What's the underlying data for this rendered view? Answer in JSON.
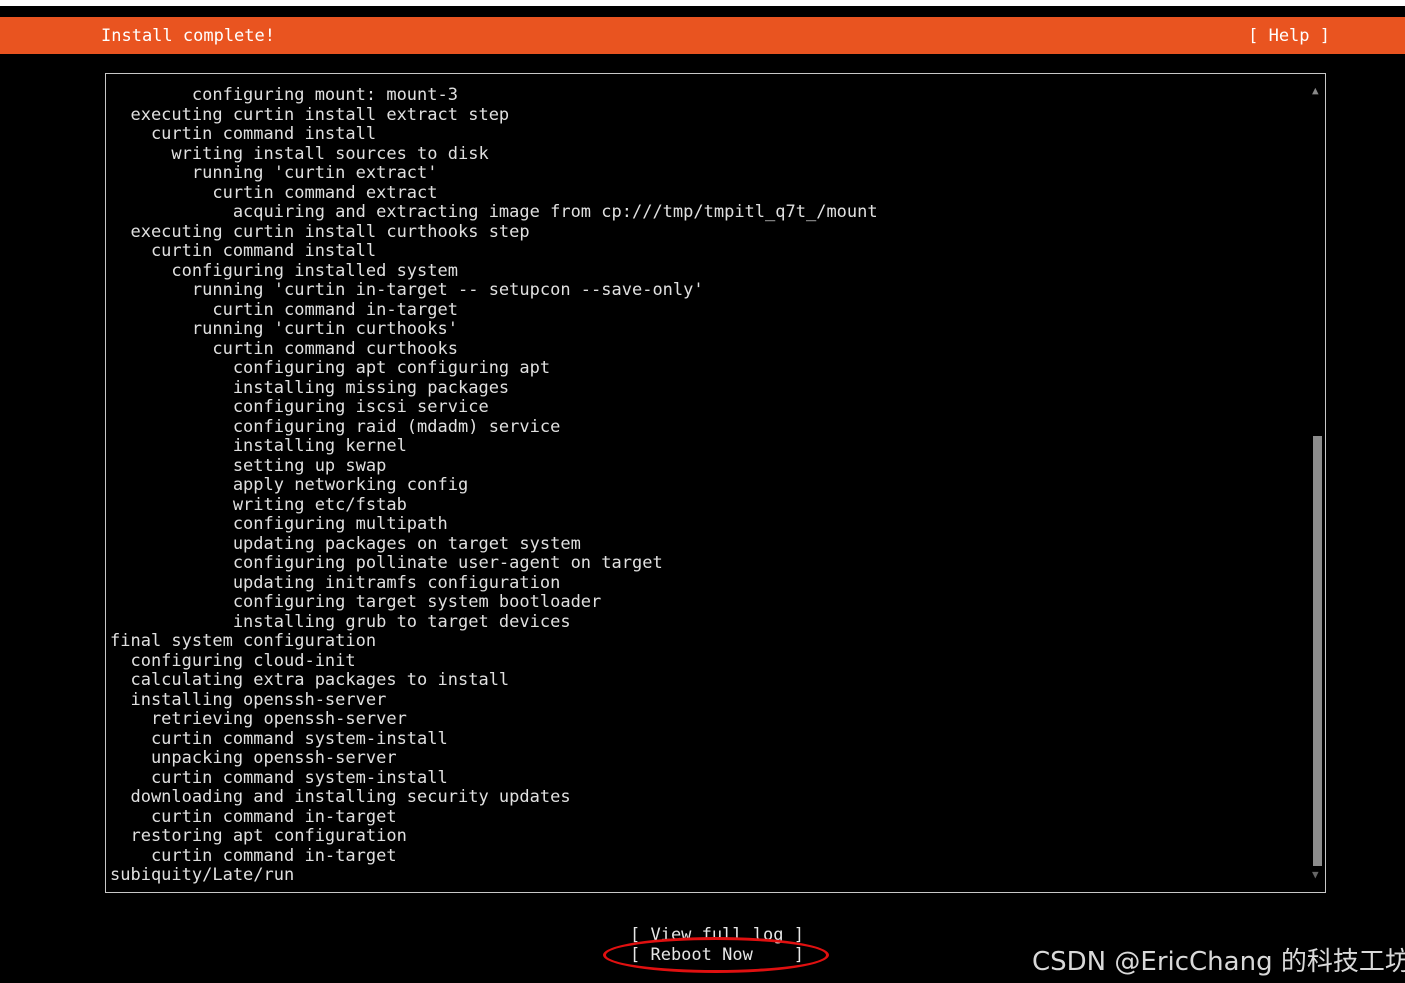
{
  "header": {
    "title": "Install complete!",
    "help_label": "[ Help ]",
    "accent_color": "#e95420"
  },
  "log": {
    "lines": [
      "        configuring mount: mount-3",
      "  executing curtin install extract step",
      "    curtin command install",
      "      writing install sources to disk",
      "        running 'curtin extract'",
      "          curtin command extract",
      "            acquiring and extracting image from cp:///tmp/tmpitl_q7t_/mount",
      "  executing curtin install curthooks step",
      "    curtin command install",
      "      configuring installed system",
      "        running 'curtin in-target -- setupcon --save-only'",
      "          curtin command in-target",
      "        running 'curtin curthooks'",
      "          curtin command curthooks",
      "            configuring apt configuring apt",
      "            installing missing packages",
      "            configuring iscsi service",
      "            configuring raid (mdadm) service",
      "            installing kernel",
      "            setting up swap",
      "            apply networking config",
      "            writing etc/fstab",
      "            configuring multipath",
      "            updating packages on target system",
      "            configuring pollinate user-agent on target",
      "            updating initramfs configuration",
      "            configuring target system bootloader",
      "            installing grub to target devices",
      "final system configuration",
      "  configuring cloud-init",
      "  calculating extra packages to install",
      "  installing openssh-server",
      "    retrieving openssh-server",
      "    curtin command system-install",
      "    unpacking openssh-server",
      "    curtin command system-install",
      "  downloading and installing security updates",
      "    curtin command in-target",
      "  restoring apt configuration",
      "    curtin command in-target",
      "subiquity/Late/run"
    ]
  },
  "scrollbar": {
    "up_arrow": "▲",
    "down_arrow": "▼"
  },
  "buttons": {
    "view_full_log": "[ View full log ]",
    "reboot_now": "[ Reboot Now    ]"
  },
  "watermark": "CSDN @EricChang 的科技工坊"
}
